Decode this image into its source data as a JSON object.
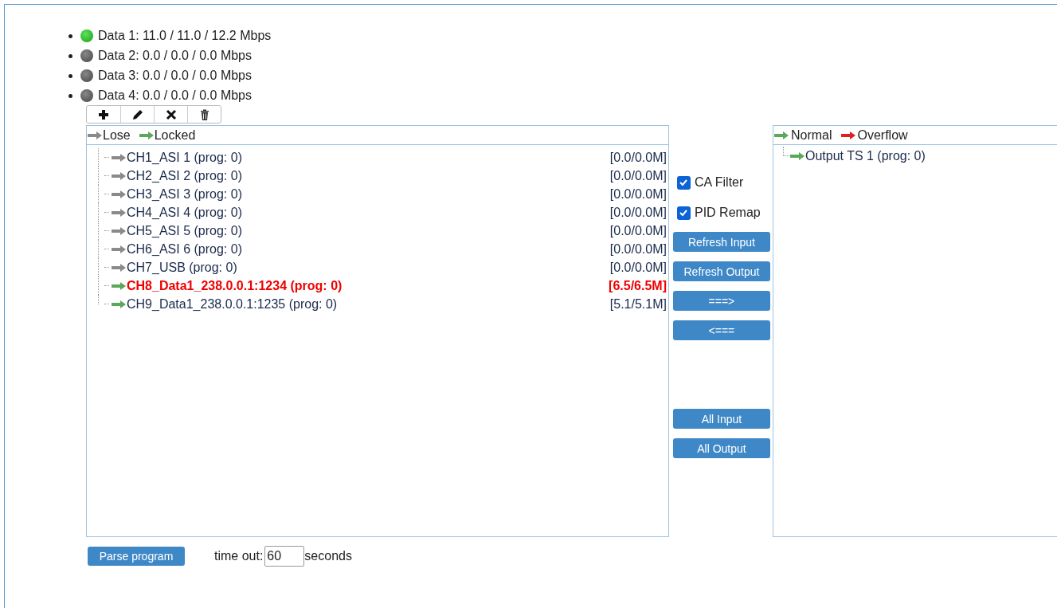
{
  "streams": [
    {
      "label": "Data 1: 11.0 / 11.0 / 12.2 Mbps",
      "active": true
    },
    {
      "label": "Data 2: 0.0 / 0.0 / 0.0 Mbps",
      "active": false
    },
    {
      "label": "Data 3: 0.0 / 0.0 / 0.0 Mbps",
      "active": false
    },
    {
      "label": "Data 4: 0.0 / 0.0 / 0.0 Mbps",
      "active": false
    }
  ],
  "toolbar": [
    {
      "kind": "add"
    },
    {
      "kind": "edit"
    },
    {
      "kind": "remove"
    },
    {
      "kind": "delete"
    }
  ],
  "input_legend": [
    {
      "color": "#8a8a8a",
      "label": "Lose"
    },
    {
      "color": "#5aa85a",
      "label": "Locked"
    }
  ],
  "inputs": [
    {
      "color": "#8a8a8a",
      "label": "CH1_ASI 1 (prog: 0)",
      "rate": "[0.0/0.0M]",
      "selected": false
    },
    {
      "color": "#8a8a8a",
      "label": "CH2_ASI 2 (prog: 0)",
      "rate": "[0.0/0.0M]",
      "selected": false
    },
    {
      "color": "#8a8a8a",
      "label": "CH3_ASI 3 (prog: 0)",
      "rate": "[0.0/0.0M]",
      "selected": false
    },
    {
      "color": "#8a8a8a",
      "label": "CH4_ASI 4 (prog: 0)",
      "rate": "[0.0/0.0M]",
      "selected": false
    },
    {
      "color": "#8a8a8a",
      "label": "CH5_ASI 5 (prog: 0)",
      "rate": "[0.0/0.0M]",
      "selected": false
    },
    {
      "color": "#8a8a8a",
      "label": "CH6_ASI 6 (prog: 0)",
      "rate": "[0.0/0.0M]",
      "selected": false
    },
    {
      "color": "#8a8a8a",
      "label": "CH7_USB (prog: 0)",
      "rate": "[0.0/0.0M]",
      "selected": false
    },
    {
      "color": "#5aa85a",
      "label": "CH8_Data1_238.0.0.1:1234 (prog: 0)",
      "rate": "[6.5/6.5M]",
      "selected": true
    },
    {
      "color": "#5aa85a",
      "label": "CH9_Data1_238.0.0.1:1235 (prog: 0)",
      "rate": "[5.1/5.1M]",
      "selected": false
    }
  ],
  "options": [
    {
      "label": "CA Filter",
      "checked": true
    },
    {
      "label": "PID Remap",
      "checked": true
    }
  ],
  "action_buttons": [
    [
      "Refresh Input",
      "Refresh Output",
      "===>",
      "<==="
    ],
    [
      "All Input",
      "All Output"
    ]
  ],
  "output_legend": [
    {
      "color": "#5aa85a",
      "label": "Normal"
    },
    {
      "color": "#e02020",
      "label": "Overflow"
    }
  ],
  "outputs": [
    {
      "color": "#5aa85a",
      "label": "Output TS 1 (prog: 0)"
    }
  ],
  "parse_button": "Parse program",
  "timeout": {
    "label": "time out:",
    "value": "60",
    "unit": "seconds"
  }
}
